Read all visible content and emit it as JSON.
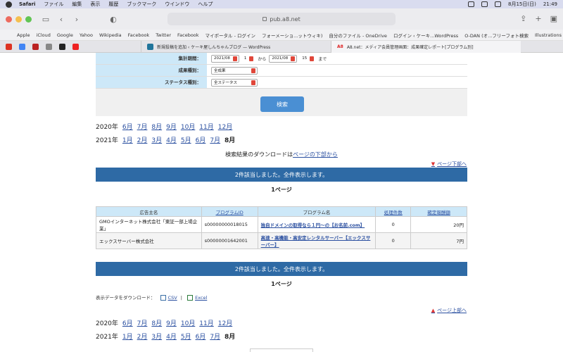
{
  "menubar": {
    "app": "Safari",
    "items": [
      "ファイル",
      "編集",
      "表示",
      "履歴",
      "ブックマーク",
      "ウインドウ",
      "ヘルプ"
    ],
    "date": "8月15日(日)",
    "time": "21:49"
  },
  "browser": {
    "url": "pub.a8.net",
    "bookmarks": [
      "Apple",
      "iCloud",
      "Google",
      "Yahoo",
      "Wikipedia",
      "Facebook",
      "Twitter",
      "Facebook",
      "マイポータル - ログイン",
      "フォーメーショ...ットウィキ)",
      "自分のファイル - OneDrive",
      "ログイン ‹ ケーキ...WordPress",
      "O-DAN (オ...フリーフォト検索",
      "Illustrations | unDraw"
    ],
    "tabs": [
      {
        "label": "新規投稿を追加 ‹ ケーキ屋しんちゃんブログ — WordPress",
        "active": false
      },
      {
        "label": "A8.net：メディア会員管理画面：成果確定レポート[プログラム別]",
        "active": true
      }
    ]
  },
  "form": {
    "period_label": "集計期間：",
    "start_month": "2021/08",
    "start_day": "1",
    "from_text": "から",
    "end_month": "2021/08",
    "end_day": "15",
    "to_text": "まで",
    "type_label": "成果種別：",
    "type_value": "全成果",
    "status_label": "ステータス種別：",
    "status_value": "全ステータス",
    "search_button": "検索"
  },
  "year_links_top": [
    {
      "year": "2020年",
      "months": [
        "6月",
        "7月",
        "8月",
        "9月",
        "10月",
        "11月",
        "12月"
      ],
      "current": ""
    },
    {
      "year": "2021年",
      "months": [
        "1月",
        "2月",
        "3月",
        "4月",
        "5月",
        "6月",
        "7月"
      ],
      "current": "8月"
    }
  ],
  "download_note": {
    "prefix": "検索結果のダウンロードは",
    "link": "ページの下部から"
  },
  "to_bottom_link": "ページ下部へ",
  "result_message": "2件該当しました。全件表示します。",
  "page_label": "1ページ",
  "table": {
    "headers": [
      "広告主名",
      "プログラムID",
      "プログラム名",
      "処理件数",
      "確定報酬額"
    ],
    "rows": [
      {
        "advertiser": "GMOインターネット株式会社「東証一部上場企業」",
        "program_id": "s00000000018015",
        "program_name": "独自ドメインの取得なら１円〜の【お名前.com】",
        "count": "0",
        "reward": "20円"
      },
      {
        "advertiser": "エックスサーバー株式会社",
        "program_id": "s00000001642001",
        "program_name": "高速・高機能・高安定レンタルサーバー【エックスサーバー】",
        "count": "0",
        "reward": "7円"
      }
    ]
  },
  "download": {
    "label": "表示データをダウンロード：",
    "csv": "CSV",
    "sep": "|",
    "excel": "Excel"
  },
  "to_top_link": "ページ上部へ",
  "year_links_bottom": [
    {
      "year": "2020年",
      "months": [
        "6月",
        "7月",
        "8月",
        "9月",
        "10月",
        "11月",
        "12月"
      ],
      "current": ""
    },
    {
      "year": "2021年",
      "months": [
        "1月",
        "2月",
        "3月",
        "4月",
        "5月",
        "6月",
        "7月"
      ],
      "current": "8月"
    }
  ]
}
